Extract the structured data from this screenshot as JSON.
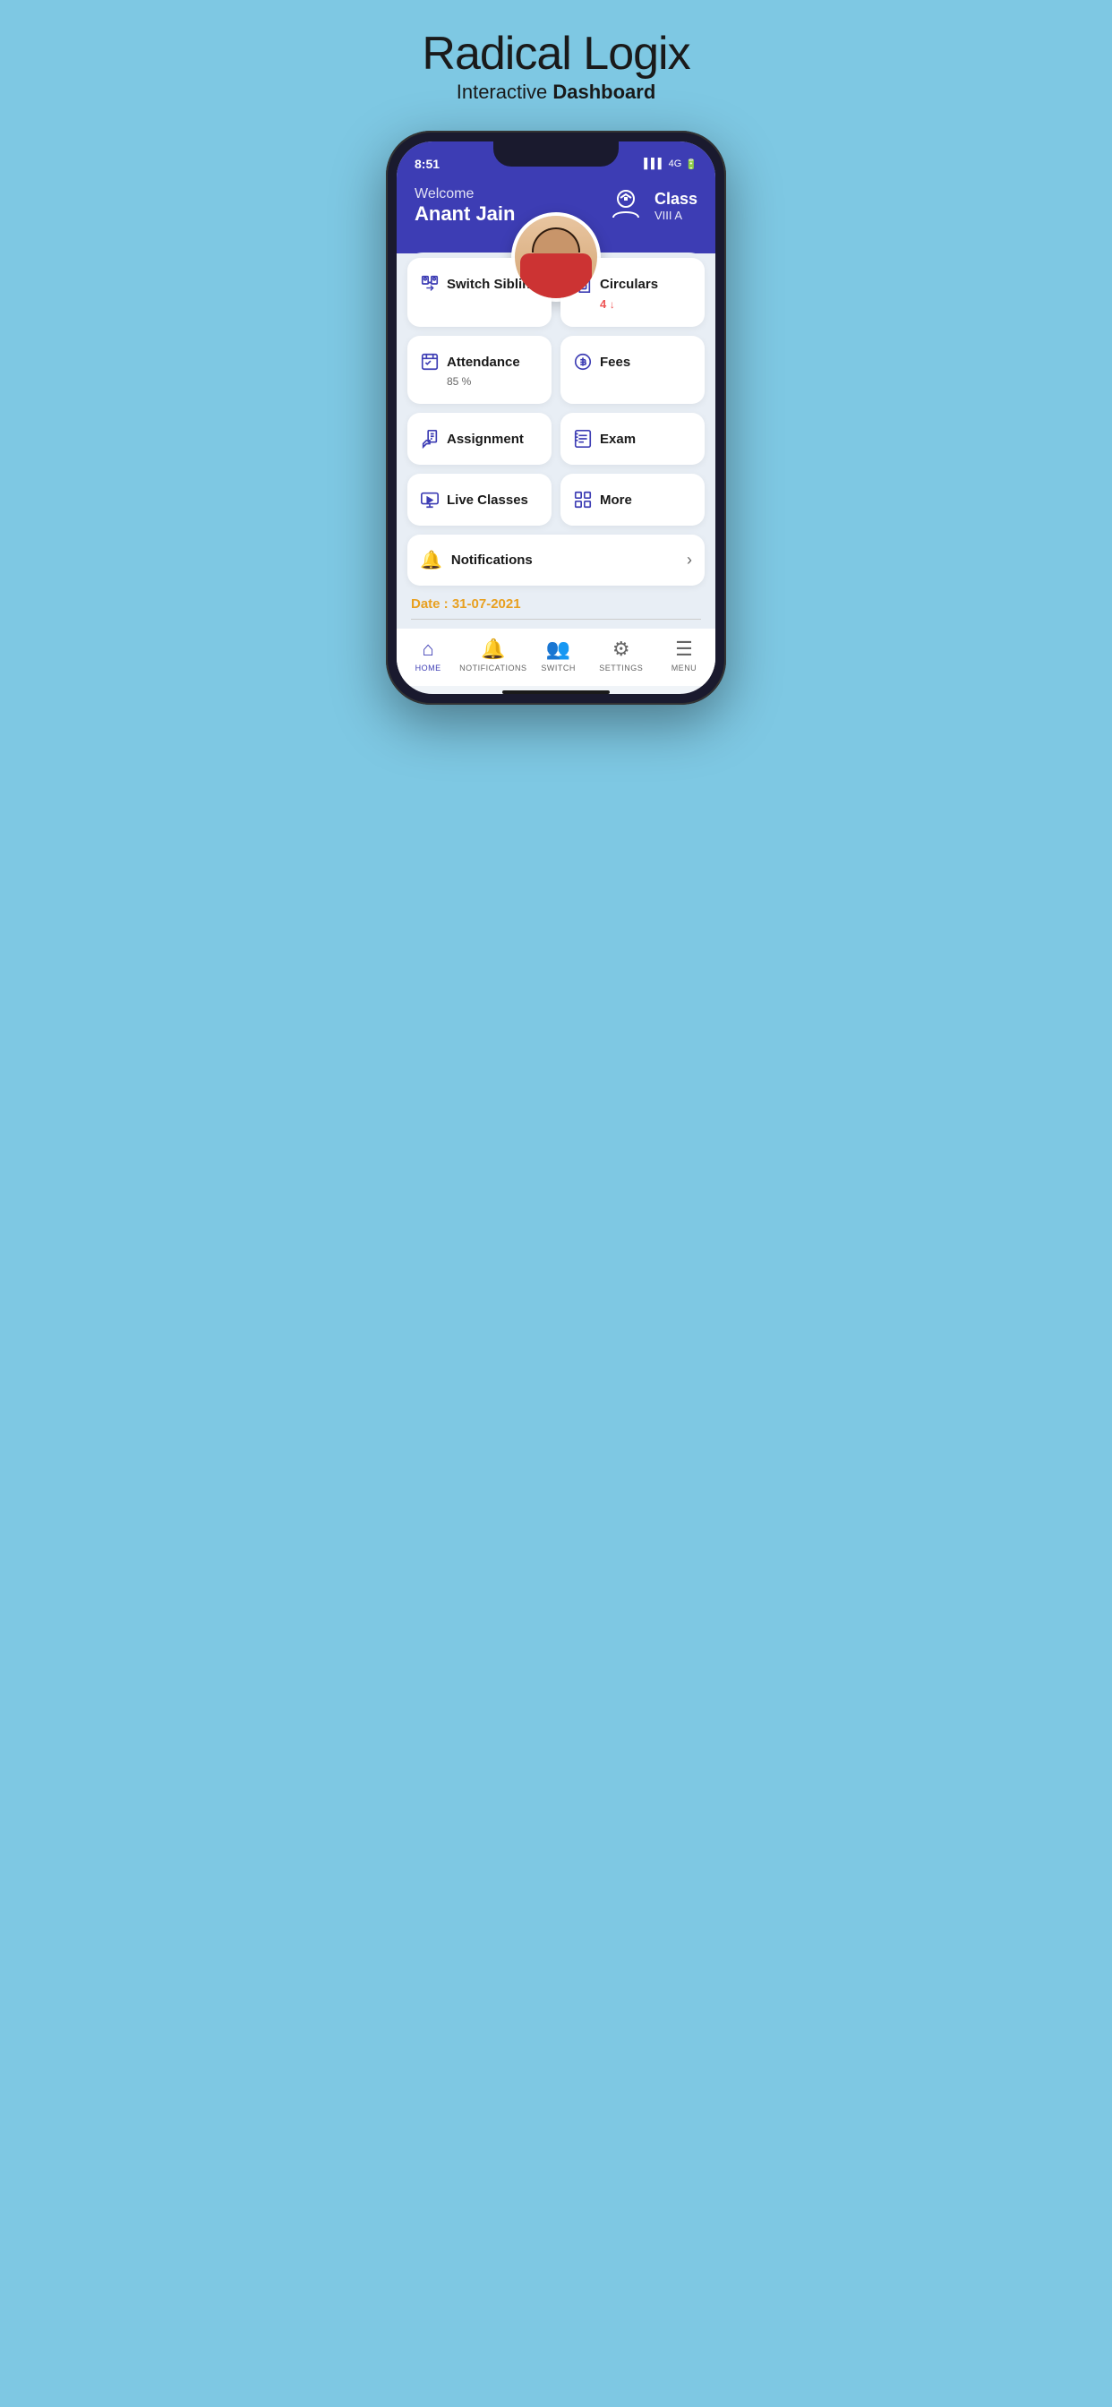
{
  "header": {
    "title": "Radical Logix",
    "subtitle_normal": "Interactive ",
    "subtitle_bold": "Dashboard"
  },
  "status_bar": {
    "time": "8:51",
    "signal": "4G"
  },
  "app_header": {
    "welcome": "Welcome",
    "user_name": "Anant  Jain",
    "class_label": "Class",
    "class_value": "VIII A"
  },
  "grid_items": [
    {
      "id": "switch-sibling",
      "label": "Switch Sibling",
      "sub": null,
      "icon": "switch"
    },
    {
      "id": "circulars",
      "label": "Circulars",
      "sub": "4 ↓",
      "icon": "circulars"
    },
    {
      "id": "attendance",
      "label": "Attendance",
      "sub": "85 %",
      "icon": "attendance"
    },
    {
      "id": "fees",
      "label": "Fees",
      "sub": null,
      "icon": "fees"
    },
    {
      "id": "assignment",
      "label": "Assignment",
      "sub": null,
      "icon": "assignment"
    },
    {
      "id": "exam",
      "label": "Exam",
      "sub": null,
      "icon": "exam"
    },
    {
      "id": "live-classes",
      "label": "Live Classes",
      "sub": null,
      "icon": "liveclasses"
    },
    {
      "id": "more",
      "label": "More",
      "sub": null,
      "icon": "more"
    }
  ],
  "notifications": {
    "label": "Notifications"
  },
  "date": {
    "label": "Date : 31-07-2021"
  },
  "bottom_nav": [
    {
      "id": "home",
      "label": "HOME",
      "active": true
    },
    {
      "id": "notifications",
      "label": "NOTIFICATIONS",
      "active": false
    },
    {
      "id": "switch",
      "label": "SWITCH",
      "active": false
    },
    {
      "id": "settings",
      "label": "SETTINGS",
      "active": false
    },
    {
      "id": "menu",
      "label": "MENU",
      "active": false
    }
  ]
}
